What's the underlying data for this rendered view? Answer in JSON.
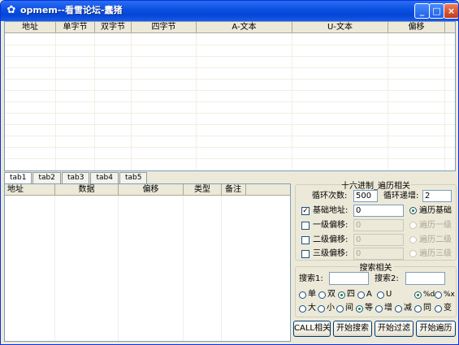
{
  "window": {
    "title": "opmem--看雪论坛-蠢猪",
    "icon": "bug-icon",
    "controls": {
      "minimize": "_",
      "maximize": "□",
      "close": "×"
    }
  },
  "top_grid": {
    "columns": [
      "地址",
      "单字节",
      "双字节",
      "四字节",
      "A-文本",
      "U-文本",
      "偏移"
    ]
  },
  "tabs": [
    "tab1",
    "tab2",
    "tab3",
    "tab4",
    "tab5"
  ],
  "bottom_grid": {
    "columns": [
      "地址",
      "数据",
      "偏移",
      "类型",
      "备注"
    ]
  },
  "hex_group": {
    "title": "十六进制_遍历相关",
    "loop_count_label": "循环次数:",
    "loop_count_value": "500",
    "loop_inc_label": "循环递增:",
    "loop_inc_value": "2",
    "base_addr_label": "基础地址:",
    "base_addr_value": "0",
    "base_addr_checked": true,
    "offset1_label": "一级偏移:",
    "offset1_value": "0",
    "offset2_label": "二级偏移:",
    "offset2_value": "0",
    "offset3_label": "三级偏移:",
    "offset3_value": "0",
    "radio_base": "遍历基础",
    "radio_level1": "遍历一级",
    "radio_level2": "遍历二级",
    "radio_level3": "遍历三级"
  },
  "search_group": {
    "title": "搜索相关",
    "search1_label": "搜索1:",
    "search1_value": "",
    "search2_label": "搜索2:",
    "search2_value": "",
    "type_options": [
      "单",
      "双",
      "四",
      "A",
      "U"
    ],
    "type_selected": "四",
    "format_options": [
      "%d",
      "%x"
    ],
    "format_selected": "%d",
    "compare_options": [
      "大",
      "小",
      "间",
      "等",
      "增",
      "减",
      "同",
      "变"
    ],
    "compare_selected": "等"
  },
  "buttons": {
    "call": "CALL相关",
    "start_search": "开始搜索",
    "start_filter": "开始过滤",
    "start_traverse": "开始遍历"
  }
}
